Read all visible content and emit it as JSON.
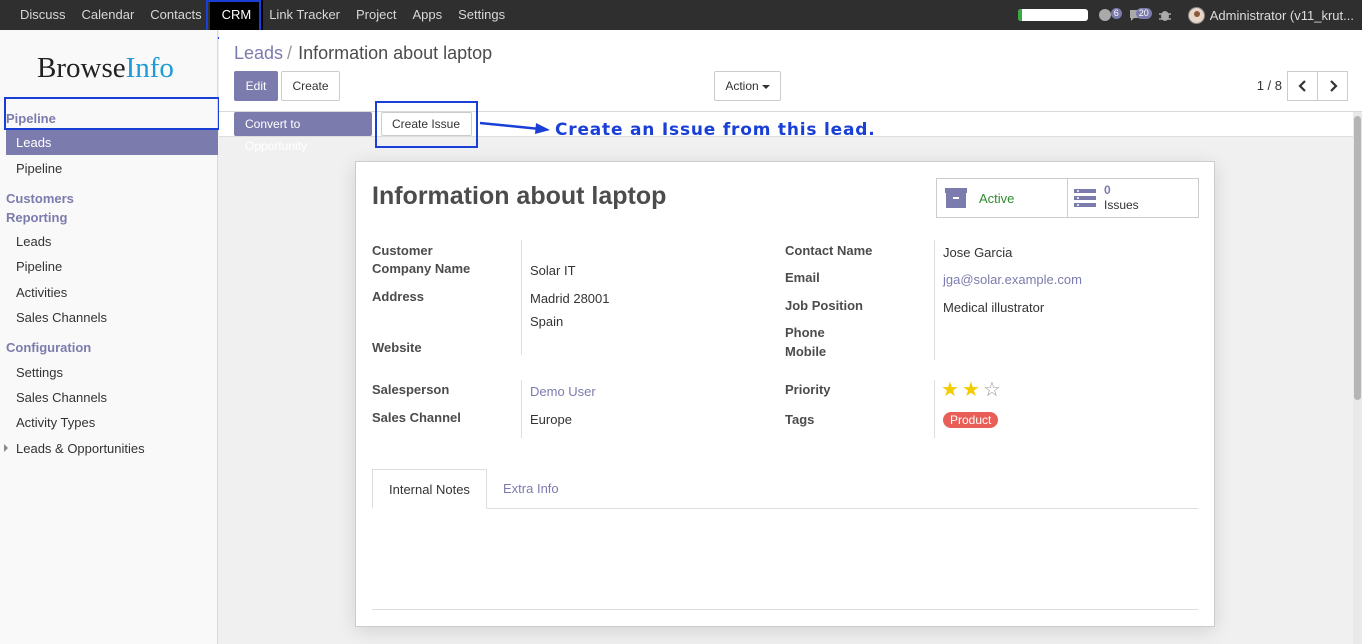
{
  "topbar": {
    "menu": [
      "Discuss",
      "Calendar",
      "Contacts",
      "CRM",
      "Link Tracker",
      "Project",
      "Apps",
      "Settings"
    ],
    "active_menu": "CRM",
    "progress": 0.06,
    "chat_count": "6",
    "activity_count": "20",
    "user": "Administrator (v11_krut..."
  },
  "sidebar": {
    "logo_part1": "Browse",
    "logo_part2": "Info",
    "pipeline_header": "Pipeline",
    "pipeline_items": [
      "Leads",
      "Pipeline"
    ],
    "customers_header": "Customers",
    "reporting_header": "Reporting",
    "reporting_items": [
      "Leads",
      "Pipeline",
      "Activities",
      "Sales Channels"
    ],
    "configuration_header": "Configuration",
    "configuration_items": [
      "Settings",
      "Sales Channels",
      "Activity Types",
      "Leads & Opportunities"
    ]
  },
  "control": {
    "breadcrumb_root": "Leads",
    "breadcrumb_sep": "/",
    "breadcrumb_current": "Information about laptop",
    "edit_label": "Edit",
    "create_label": "Create",
    "action_label": "Action",
    "pager": "1 / 8"
  },
  "statusbar": {
    "convert_label": "Convert to Opportunity",
    "create_issue_label": "Create Issue",
    "annotation": "Create an Issue from this lead."
  },
  "form": {
    "title": "Information about laptop",
    "active_label": "Active",
    "issues_count": "0",
    "issues_label": "Issues",
    "customer_label": "Customer",
    "company_label": "Company Name",
    "company_value": "Solar IT",
    "address_label": "Address",
    "address_line1": "Madrid 28001",
    "address_line2": "Spain",
    "website_label": "Website",
    "contact_label": "Contact Name",
    "contact_value": "Jose Garcia",
    "email_label": "Email",
    "email_value": "jga@solar.example.com",
    "job_label": "Job Position",
    "job_value": "Medical illustrator",
    "phone_label": "Phone",
    "mobile_label": "Mobile",
    "salesperson_label": "Salesperson",
    "salesperson_value": "Demo User",
    "channel_label": "Sales Channel",
    "channel_value": "Europe",
    "priority_label": "Priority",
    "priority_value": 2,
    "priority_max": 3,
    "tags_label": "Tags",
    "tag_value": "Product",
    "tab_notes": "Internal Notes",
    "tab_extra": "Extra Info"
  },
  "colors": {
    "accent": "#7c7bad",
    "annotation": "#1a3fd6",
    "tag": "#e95f57",
    "star": "#f3cc00"
  }
}
